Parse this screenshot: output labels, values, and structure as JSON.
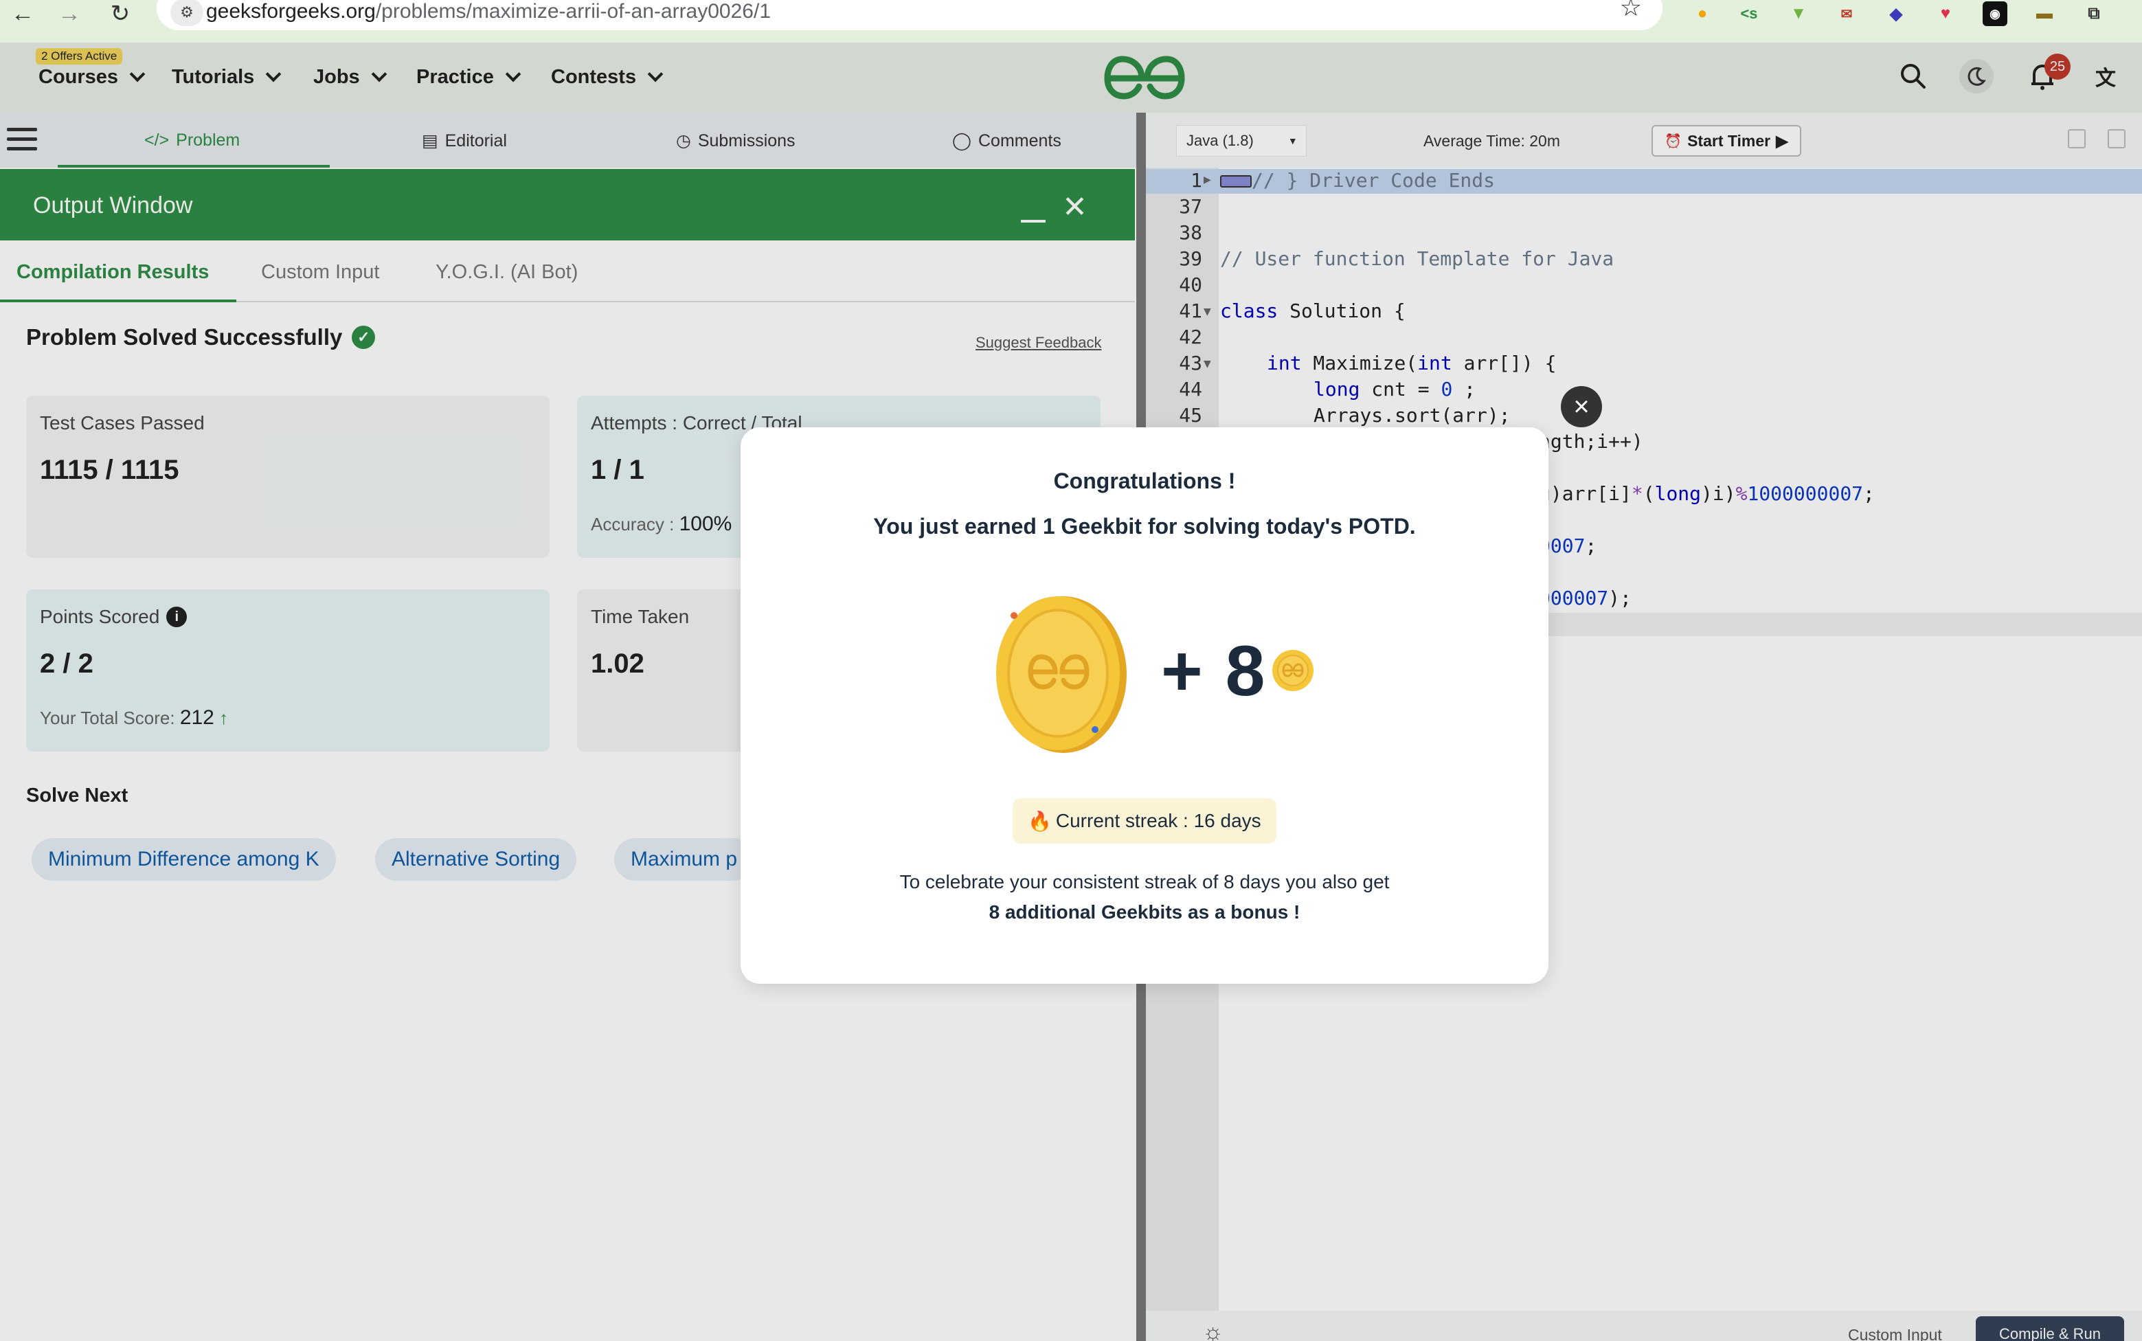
{
  "browser": {
    "url_domain": "geeksforgeeks.org",
    "url_path": "/problems/maximize-arrii-of-an-array0026/1"
  },
  "header": {
    "offers_badge": "2 Offers Active",
    "menu": [
      "Courses",
      "Tutorials",
      "Jobs",
      "Practice",
      "Contests"
    ],
    "notification_count": "25",
    "brand_color": "#2f8d46"
  },
  "problem_tabs": [
    "Problem",
    "Editorial",
    "Submissions",
    "Comments"
  ],
  "output_window": {
    "title": "Output Window",
    "tabs": [
      "Compilation Results",
      "Custom Input",
      "Y.O.G.I. (AI Bot)"
    ],
    "status": "Problem Solved Successfully",
    "suggest_feedback": "Suggest Feedback",
    "cards": {
      "test_cases_label": "Test Cases Passed",
      "test_cases_value": "1115 / 1115",
      "attempts_label": "Attempts : Correct / Total",
      "attempts_value": "1 / 1",
      "accuracy_label": "Accuracy :",
      "accuracy_value": "100%",
      "points_label": "Points Scored",
      "points_value": "2 / 2",
      "total_score_label": "Your Total Score:",
      "total_score_value": "212",
      "time_label": "Time Taken",
      "time_value": "1.02"
    },
    "solve_next_title": "Solve Next",
    "solve_next": [
      "Minimum Difference among K",
      "Alternative Sorting",
      "Maximum p"
    ]
  },
  "editor": {
    "language": "Java (1.8)",
    "avg_time": "Average Time: 20m",
    "start_timer": "Start Timer",
    "line_numbers": [
      "1",
      "37",
      "38",
      "39",
      "40",
      "41",
      "42",
      "43",
      "44",
      "45"
    ],
    "code": {
      "l1": "// } Driver Code Ends",
      "l39": "// User function Template for Java",
      "l41_kw": "class",
      "l41_rest": " Solution {",
      "l43_kw1": "int",
      "l43_mid": " Maximize(",
      "l43_kw2": "int",
      "l43_rest": " arr[]) {",
      "l44_kw": "long",
      "l44_rest": " cnt = ",
      "l44_num": "0",
      "l44_end": " ;",
      "l45": "Arrays.sort(arr);",
      "frag1": "ngth;i++)",
      "frag2_a": "g",
      "frag2_b": ")arr[i]",
      "frag2_c": "*",
      "frag2_d": "(",
      "frag2_e": "long",
      "frag2_f": ")i)",
      "frag2_g": "%",
      "frag2_h": "1000000007",
      "frag2_i": ";",
      "frag3_num": "0007",
      "frag3_end": ";",
      "frag4_num": "000007",
      "frag4_end": ");"
    },
    "footer_custom_input": "Custom Input",
    "footer_compile": "Compile & Run"
  },
  "modal": {
    "title": "Congratulations !",
    "subtitle": "You just earned 1 Geekbit for solving today's POTD.",
    "plus_amount": "+ 8",
    "streak": "Current streak : 16 days",
    "message_line1": "To celebrate your consistent streak of 8 days you also get",
    "message_line2": "8 additional Geekbits as a bonus !",
    "coin_color": "#f5c63a"
  }
}
